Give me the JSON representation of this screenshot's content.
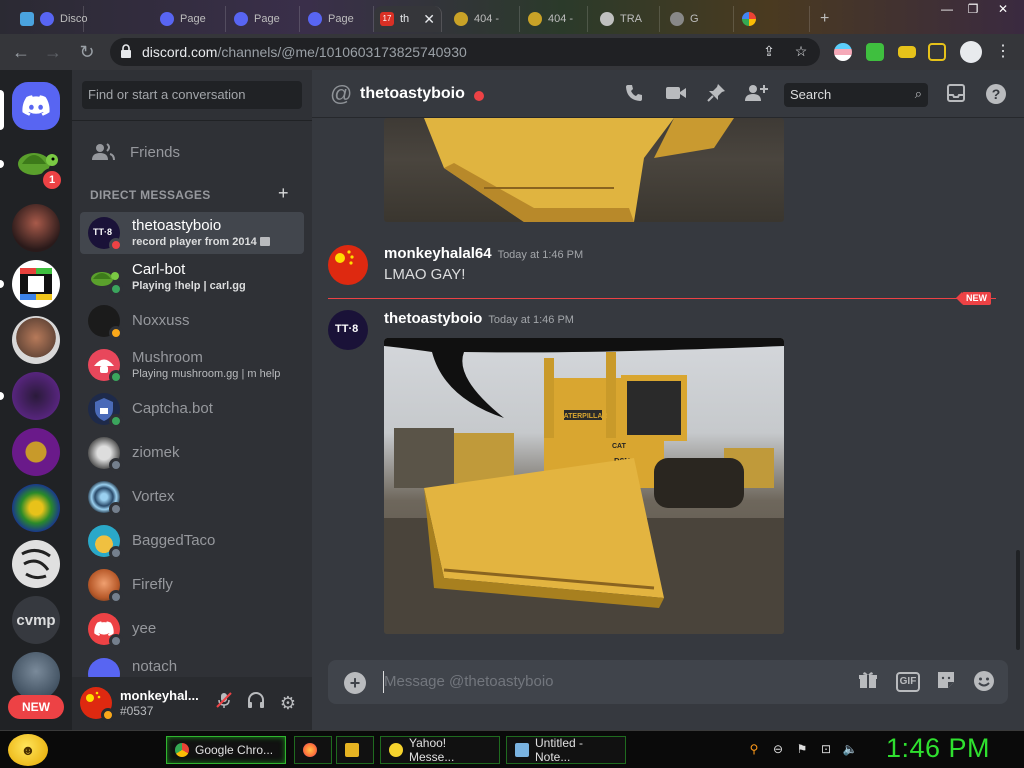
{
  "browser": {
    "tabs": [
      {
        "label": "Disco"
      },
      {
        "label": "Page"
      },
      {
        "label": "Page"
      },
      {
        "label": "Page"
      },
      {
        "label": "th"
      },
      {
        "label": "404 -"
      },
      {
        "label": "404 -"
      },
      {
        "label": "TRA"
      },
      {
        "label": "G"
      }
    ],
    "url_host": "discord.com",
    "url_path": "/channels/@me/1010603173825740930"
  },
  "servers": {
    "home_badge": "1",
    "text_server": "cvmp",
    "new_label": "NEW"
  },
  "dm_sidebar": {
    "search_placeholder": "Find or start a conversation",
    "friends_label": "Friends",
    "section_header": "DIRECT MESSAGES",
    "items": [
      {
        "name": "thetoastyboio",
        "sub": "record player from 2014",
        "status": "dnd",
        "avatar_text": "TT·8",
        "avatar_color": "#1a1238"
      },
      {
        "name": "Carl-bot",
        "sub_prefix": "Playing ",
        "sub": "!help | carl.gg",
        "status": "online",
        "avatar_text": "",
        "avatar_color": "#2f3136"
      },
      {
        "name": "Noxxuss",
        "sub": "",
        "status": "idle",
        "avatar_text": "",
        "avatar_color": "#1b1b1b"
      },
      {
        "name": "Mushroom",
        "sub_prefix": "Playing ",
        "sub": "mushroom.gg | m help",
        "status": "online",
        "avatar_text": "",
        "avatar_color": "#e8475b"
      },
      {
        "name": "Captcha.bot",
        "sub": "",
        "status": "online",
        "avatar_text": "",
        "avatar_color": "#1e2a4a"
      },
      {
        "name": "ziomek",
        "sub": "",
        "status": "offline",
        "avatar_text": "",
        "avatar_color": "#6b6b6b"
      },
      {
        "name": "Vortex",
        "sub": "",
        "status": "offline",
        "avatar_text": "",
        "avatar_color": "#2a3a4a"
      },
      {
        "name": "BaggedTaco",
        "sub": "",
        "status": "offline",
        "avatar_text": "",
        "avatar_color": "#2aa8c8"
      },
      {
        "name": "Firefly",
        "sub": "",
        "status": "offline",
        "avatar_text": "",
        "avatar_color": "#c87a3a"
      },
      {
        "name": "yee",
        "sub": "",
        "status": "offline",
        "avatar_text": "",
        "avatar_color": "#ed4245"
      },
      {
        "name": "notach",
        "sub": "",
        "status": "offline",
        "avatar_text": "",
        "avatar_color": "#5865f2"
      }
    ]
  },
  "user_panel": {
    "name": "monkeyhal...",
    "tag": "#0537"
  },
  "chat": {
    "recipient": "thetoastyboio",
    "search_placeholder": "Search",
    "messages": [
      {
        "author": "monkeyhalal64",
        "time": "Today at 1:46 PM",
        "text": "LMAO GAY!"
      },
      {
        "author": "thetoastyboio",
        "time": "Today at 1:46 PM",
        "text": ""
      }
    ],
    "new_marker": "NEW",
    "image_text": {
      "brand": "CATERPILLAR",
      "model": "D8N",
      "short": "CAT"
    },
    "composer_placeholder": "Message @thetoastyboio",
    "gif_label": "GIF"
  },
  "taskbar": {
    "tasks": [
      {
        "label": "Google Chro...",
        "icon_color": "#4285f4"
      },
      {
        "label": "",
        "icon_color": "#ff7139"
      },
      {
        "label": "",
        "icon_color": "#e6b422"
      },
      {
        "label": "Yahoo! Messe...",
        "icon_color": "#f6d32d"
      },
      {
        "label": "Untitled - Note...",
        "icon_color": "#7ab3e0"
      }
    ],
    "clock": "1:46 PM"
  },
  "colors": {
    "blurple": "#5865f2",
    "dnd": "#ed4245",
    "online": "#3ba55d",
    "idle": "#faa81a",
    "clock": "#2fe02f"
  }
}
